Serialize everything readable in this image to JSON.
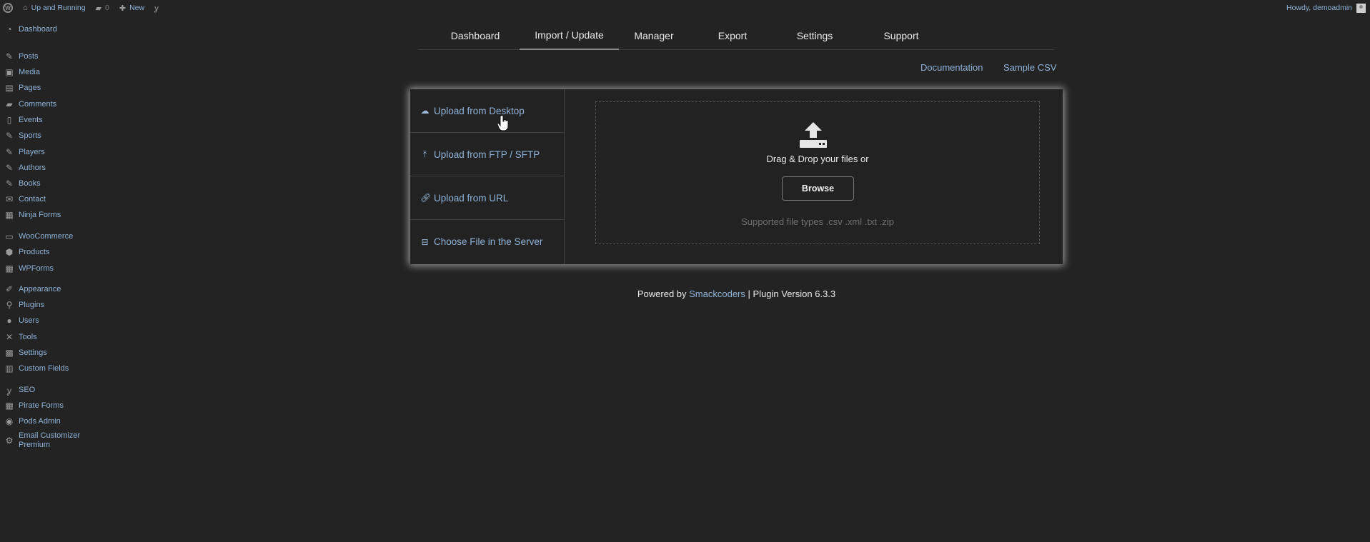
{
  "adminbar": {
    "site_name": "Up and Running",
    "comments_count": "0",
    "new_label": "New",
    "howdy": "Howdy, demoadmin"
  },
  "sidebar": {
    "items": [
      {
        "label": "Dashboard",
        "icon": "dashboard-icon"
      },
      {
        "label": "Posts",
        "icon": "pin-icon"
      },
      {
        "label": "Media",
        "icon": "media-icon"
      },
      {
        "label": "Pages",
        "icon": "pages-icon"
      },
      {
        "label": "Comments",
        "icon": "comment-icon"
      },
      {
        "label": "Events",
        "icon": "events-icon"
      },
      {
        "label": "Sports",
        "icon": "pin-icon"
      },
      {
        "label": "Players",
        "icon": "pin-icon"
      },
      {
        "label": "Authors",
        "icon": "pin-icon"
      },
      {
        "label": "Books",
        "icon": "pin-icon"
      },
      {
        "label": "Contact",
        "icon": "mail-icon"
      },
      {
        "label": "Ninja Forms",
        "icon": "form-icon"
      },
      {
        "label": "WooCommerce",
        "icon": "woo-icon"
      },
      {
        "label": "Products",
        "icon": "box-icon"
      },
      {
        "label": "WPForms",
        "icon": "form-icon"
      },
      {
        "label": "Appearance",
        "icon": "brush-icon"
      },
      {
        "label": "Plugins",
        "icon": "plugin-icon"
      },
      {
        "label": "Users",
        "icon": "user-icon"
      },
      {
        "label": "Tools",
        "icon": "wrench-icon"
      },
      {
        "label": "Settings",
        "icon": "settings-icon"
      },
      {
        "label": "Custom Fields",
        "icon": "fields-icon"
      },
      {
        "label": "SEO",
        "icon": "yoast-icon"
      },
      {
        "label": "Pirate Forms",
        "icon": "form-icon"
      },
      {
        "label": "Pods Admin",
        "icon": "pods-icon"
      },
      {
        "label": "Email Customizer Premium",
        "icon": "gear-icon"
      }
    ]
  },
  "tabs": [
    {
      "label": "Dashboard"
    },
    {
      "label": "Import / Update"
    },
    {
      "label": "Manager"
    },
    {
      "label": "Export"
    },
    {
      "label": "Settings"
    },
    {
      "label": "Support"
    }
  ],
  "links": {
    "documentation": "Documentation",
    "sample_csv": "Sample CSV"
  },
  "upload_options": [
    {
      "label": "Upload from Desktop"
    },
    {
      "label": "Upload from FTP / SFTP"
    },
    {
      "label": "Upload from URL"
    },
    {
      "label": "Choose File in the Server"
    }
  ],
  "dropzone": {
    "text": "Drag & Drop your files or",
    "browse_label": "Browse",
    "supported": "Supported file types .csv .xml .txt .zip"
  },
  "footer": {
    "powered_by": "Powered by",
    "brand": "Smackcoders",
    "version": "| Plugin Version 6.3.3"
  },
  "colors": {
    "background": "#232323",
    "link": "#8fb3d9",
    "text": "#eaeaea"
  }
}
